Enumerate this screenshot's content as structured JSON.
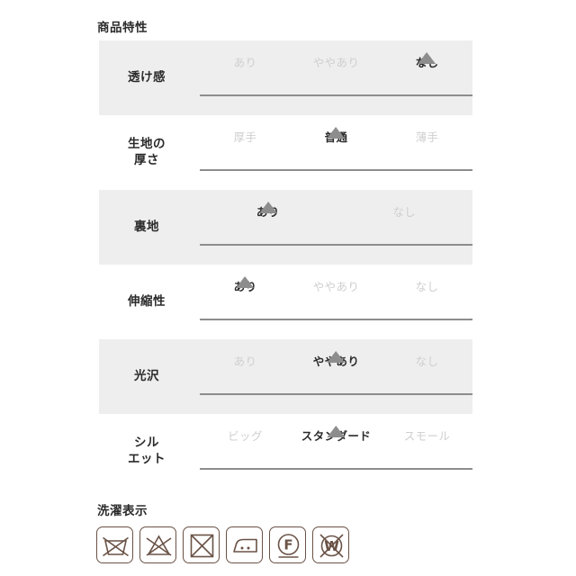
{
  "specs": {
    "heading": "商品特性",
    "rows": [
      {
        "label_lines": [
          "透け感"
        ],
        "shaded": true,
        "options": [
          {
            "label": "あり",
            "active": false
          },
          {
            "label": "ややあり",
            "active": false
          },
          {
            "label": "なし",
            "active": true
          }
        ],
        "selected": "なし"
      },
      {
        "label_lines": [
          "生地の",
          "厚さ"
        ],
        "shaded": false,
        "options": [
          {
            "label": "厚手",
            "active": false
          },
          {
            "label": "普通",
            "active": true
          },
          {
            "label": "薄手",
            "active": false
          }
        ],
        "selected": "普通"
      },
      {
        "label_lines": [
          "裏地"
        ],
        "shaded": true,
        "options": [
          {
            "label": "あり",
            "active": true
          },
          {
            "label": "なし",
            "active": false
          }
        ],
        "selected": "あり"
      },
      {
        "label_lines": [
          "伸縮性"
        ],
        "shaded": false,
        "options": [
          {
            "label": "あり",
            "active": true
          },
          {
            "label": "ややあり",
            "active": false
          },
          {
            "label": "なし",
            "active": false
          }
        ],
        "selected": "あり"
      },
      {
        "label_lines": [
          "光沢"
        ],
        "shaded": true,
        "options": [
          {
            "label": "あり",
            "active": false
          },
          {
            "label": "ややあり",
            "active": true
          },
          {
            "label": "なし",
            "active": false
          }
        ],
        "selected": "ややあり"
      },
      {
        "label_lines": [
          "シル",
          "エット"
        ],
        "shaded": false,
        "options": [
          {
            "label": "ビッグ",
            "active": false
          },
          {
            "label": "スタンダード",
            "active": true
          },
          {
            "label": "スモール",
            "active": false
          }
        ],
        "selected": "スタンダード"
      }
    ]
  },
  "care": {
    "heading": "洗濯表示",
    "icons": [
      {
        "name": "no-machine-wash-icon",
        "glyph": "washtub-crossed"
      },
      {
        "name": "no-bleach-icon",
        "glyph": "triangle-crossed"
      },
      {
        "name": "no-tumble-dry-icon",
        "glyph": "square-crossed"
      },
      {
        "name": "iron-icon",
        "glyph": "iron"
      },
      {
        "name": "dryclean-petroleum-icon",
        "glyph": "circle-f-underline"
      },
      {
        "name": "no-wetclean-icon",
        "glyph": "circle-w-crossed"
      }
    ]
  },
  "colors": {
    "text_active": "#2b2b2b",
    "text_inactive": "#cfcfcf",
    "row_shade": "#eeeeee",
    "track": "#8d8d8d",
    "marker": "#8d8d8d",
    "care_stroke": "#6a5246"
  }
}
